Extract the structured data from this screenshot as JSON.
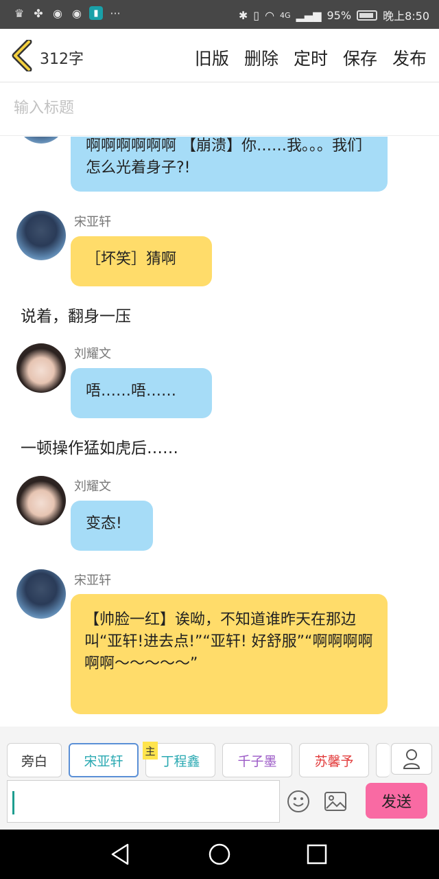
{
  "status_bar": {
    "battery": "95%",
    "time": "晚上8:50",
    "network": "4G",
    "dots": "···"
  },
  "header": {
    "word_count": "312字",
    "actions": [
      "旧版",
      "删除",
      "定时",
      "保存",
      "发布"
    ]
  },
  "title_input": {
    "placeholder": "输入标题"
  },
  "messages": {
    "m1": {
      "text": "啊啊啊啊啊啊 【崩溃】你……我。。。我们怎么光着身子?!"
    },
    "m2": {
      "speaker": "宋亚轩",
      "text": "［坏笑］猜啊"
    },
    "n1": {
      "text": "说着，翻身一压"
    },
    "m3": {
      "speaker": "刘耀文",
      "text": "唔……唔……"
    },
    "n2": {
      "text": "一顿操作猛如虎后……"
    },
    "m4": {
      "speaker": "刘耀文",
      "text": "变态!"
    },
    "m5": {
      "speaker": "宋亚轩",
      "text": "【帅脸一红】诶呦，不知道谁昨天在那边叫“亚轩!进去点!”“亚轩! 好舒服”“啊啊啊啊啊啊～～～～～”"
    }
  },
  "characters": [
    {
      "name": "旁白",
      "color": "#333333"
    },
    {
      "name": "宋亚轩",
      "color": "#2aa9b2"
    },
    {
      "name": "丁程鑫",
      "color": "#2aa9b2"
    },
    {
      "name": "千子墨",
      "color": "#9b59c6"
    },
    {
      "name": "苏馨予",
      "color": "#e23b3b"
    }
  ],
  "main_badge": "主",
  "send_label": "发送",
  "colors": {
    "bubble_blue": "#a6dcf7",
    "bubble_yellow": "#ffdc6a",
    "send_pink": "#f96aa3",
    "selected_border": "#5a8fd6"
  }
}
